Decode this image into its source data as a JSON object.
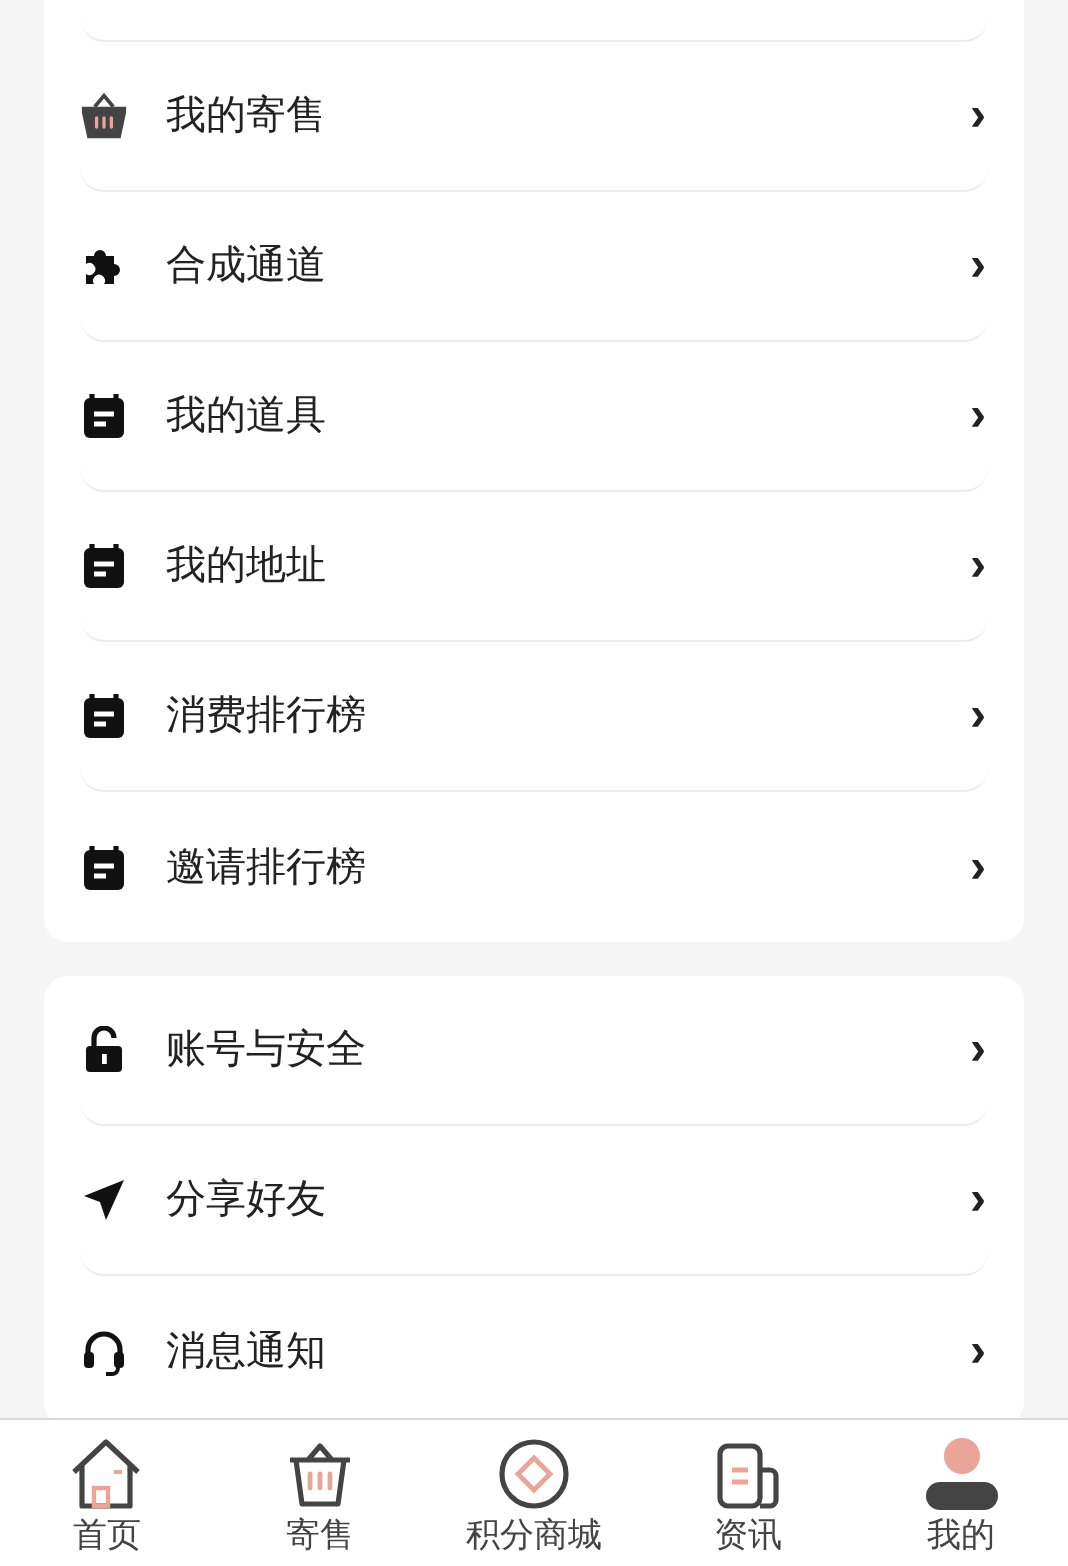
{
  "menu_groups": [
    {
      "items": [
        {
          "kind": "basket",
          "label": "我的寄售",
          "chevron": "›"
        },
        {
          "kind": "puzzle",
          "label": "合成通道",
          "chevron": "›"
        },
        {
          "kind": "calendar",
          "label": "我的道具",
          "chevron": "›"
        },
        {
          "kind": "calendar",
          "label": "我的地址",
          "chevron": "›"
        },
        {
          "kind": "calendar",
          "label": "消费排行榜",
          "chevron": "›"
        },
        {
          "kind": "calendar",
          "label": "邀请排行榜",
          "chevron": "›"
        }
      ]
    },
    {
      "items": [
        {
          "kind": "lock",
          "label": "账号与安全",
          "chevron": "›"
        },
        {
          "kind": "send",
          "label": "分享好友",
          "chevron": "›"
        },
        {
          "kind": "headset",
          "label": "消息通知",
          "chevron": "›"
        }
      ]
    }
  ],
  "tab_bar": [
    {
      "kind": "home",
      "label": "首页"
    },
    {
      "kind": "basket",
      "label": "寄售"
    },
    {
      "kind": "coin",
      "label": "积分商城"
    },
    {
      "kind": "news",
      "label": "资讯"
    },
    {
      "kind": "person",
      "label": "我的"
    }
  ]
}
